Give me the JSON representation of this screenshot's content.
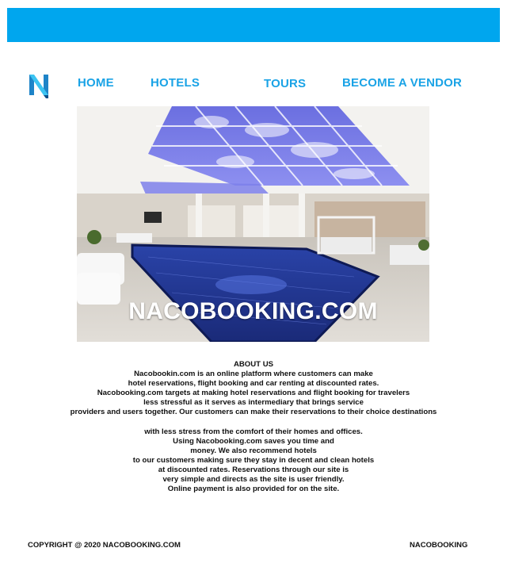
{
  "brand": {
    "logo_icon": "n-logo-icon",
    "accent_color": "#00a6ee",
    "nav_color": "#1aa3e6"
  },
  "nav": {
    "home": "HOME",
    "hotels": "HOTELS",
    "tours": "TOURS",
    "vendor": "BECOME A VENDOR"
  },
  "hero": {
    "title": "NACOBOOKING.COM"
  },
  "about": {
    "heading": "ABOUT US",
    "lines": [
      "Nacobookin.com is an online platform where customers can make",
      "hotel reservations, flight booking and car renting at discounted rates.",
      "Nacobooking.com targets at making hotel reservations and flight booking for travelers",
      "less stressful as it serves as intermediary that brings service",
      "providers and users together. Our customers can make their reservations to their choice destinations",
      "",
      "with less stress from the comfort of their homes and offices.",
      "Using Nacobooking.com saves you time and",
      "money. We also recommend hotels",
      "to our customers making sure they stay in decent and clean hotels",
      "at discounted rates. Reservations through our site is",
      "very simple and directs as the site is user friendly.",
      "Online payment is also provided for on the site."
    ]
  },
  "footer": {
    "copyright": "COPYRIGHT @ 2020 NACOBOOKING.COM",
    "brand": "NACOBOOKING"
  }
}
